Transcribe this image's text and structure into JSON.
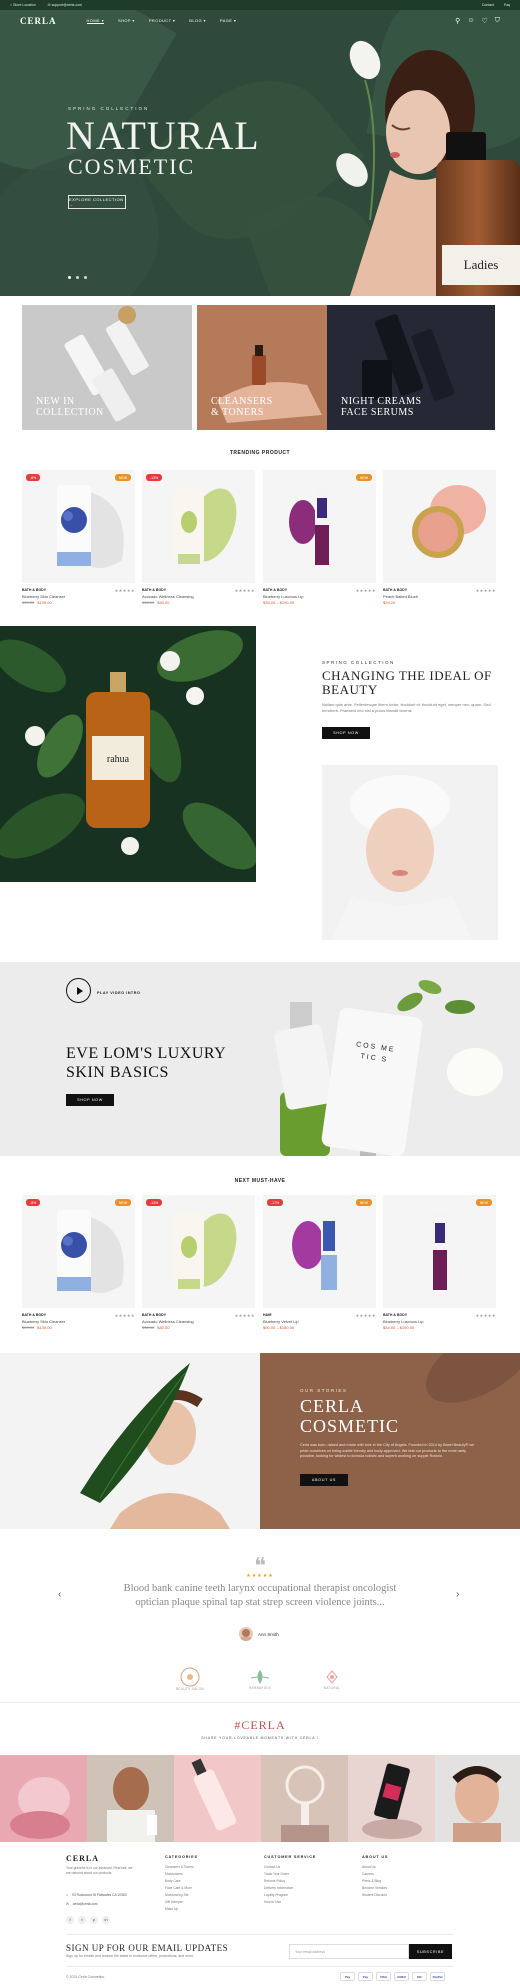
{
  "topbar": {
    "location": "Store Location",
    "email": "support@cerla.com",
    "contact": "Contact",
    "faq": "Faq"
  },
  "header": {
    "logo": "CERLA",
    "nav": [
      "HOME ▾",
      "SHOP ▾",
      "PRODUCT ▾",
      "BLOG ▾",
      "PAGE ▾"
    ],
    "cart_count": "0",
    "wishlist_count": "0"
  },
  "hero": {
    "kicker": "SPRING COLLECTION",
    "title_line1": "NATURAL",
    "title_line2": "COSMETIC",
    "button": "EXPLORE COLLECTION  →",
    "bottle_label": "Ladies"
  },
  "categories": [
    {
      "line1": "NEW IN",
      "line2": "COLLECTION"
    },
    {
      "line1": "CLEANSERS",
      "line2": "& TONERS"
    },
    {
      "line1": "NIGHT CREAMS",
      "line2": "FACE SERUMS"
    }
  ],
  "trending": {
    "title": "TRENDING PRODUCT",
    "products": [
      {
        "badge_left": "-8%",
        "badge_right": "NEW",
        "brand": "BATH & BODY",
        "stars": "★★★★★",
        "name": "Blueberry Skin Cleanser",
        "old_price": "$39.00",
        "price": "$139.00"
      },
      {
        "badge_left": "-13%",
        "badge_right": "",
        "brand": "BATH & BODY",
        "stars": "★★★★★",
        "name": "Avocado Wellness Cleansing",
        "old_price": "$38.00",
        "price": "$40.00"
      },
      {
        "badge_left": "",
        "badge_right": "NEW",
        "brand": "BATH & BODY",
        "stars": "★★★★★",
        "name": "Blueberry Luscious Lip",
        "old_price": "",
        "price": "$35.00 – $190.00"
      },
      {
        "badge_left": "",
        "badge_right": "",
        "brand": "BATH & BODY",
        "stars": "★★★★★",
        "name": "Peach Baked Blush",
        "old_price": "",
        "price": "$24.20"
      }
    ]
  },
  "spring": {
    "kicker": "SPRING COLLECTION",
    "title": "CHANGING THE IDEAL OF BEAUTY",
    "text": "Nullam quis ante. Pellentesque libero tortor, tincidunt et, tincidunt eget, semper nec, quam. Sed hendrerit. Praesent nec nisl a purus blandit viverra.",
    "button": "SHOP NOW",
    "product_label": "rahua"
  },
  "video": {
    "play_label": "PLAY VIDEO INTRO",
    "title_line1": "EVE LOM'S LUXURY",
    "title_line2": "SKIN BASICS",
    "button": "SHOP NOW",
    "bottle_text": "COS ME TIC S"
  },
  "must_have": {
    "title": "NEXT MUST-HAVE",
    "products": [
      {
        "badge_left": "-8%",
        "badge_right": "NEW",
        "brand": "BATH & BODY",
        "stars": "★★★★★",
        "name": "Blueberry Skin Cleanser",
        "old_price": "$39.00",
        "price": "$139.00"
      },
      {
        "badge_left": "-13%",
        "badge_right": "",
        "brand": "BATH & BODY",
        "stars": "★★★★★",
        "name": "Avocado Wellness Cleansing",
        "old_price": "$38.00",
        "price": "$40.00"
      },
      {
        "badge_left": "-17%",
        "badge_right": "NEW",
        "brand": "HAIR",
        "stars": "★★★★★",
        "name": "Blueberry Velvet Lip",
        "old_price": "",
        "price": "$90.00 – $180.00"
      },
      {
        "badge_left": "",
        "badge_right": "NEW",
        "brand": "BATH & BODY",
        "stars": "★★★★★",
        "name": "Blueberry Luscious Lip",
        "old_price": "",
        "price": "$34.00 – $190.00"
      }
    ]
  },
  "stories": {
    "kicker": "OUR STORIES",
    "title_line1": "CERLA",
    "title_line2": "COSMETIC",
    "text": "Cerla was born, raised and made with love in the City of Angels. Founded in 2014 by Basel Beauty® we pride ourselves on being subtle friendly and body-approved. We test our products to the most rarity possible, looking for wildest to formula holistic and superb working on supple Roboto.",
    "button": "ABOUT US"
  },
  "testimonial": {
    "quote_mark": "❝",
    "stars": "★★★★★",
    "text": "Blood bank canine teeth larynx occupational therapist oncologist optician plaque spinal tap stat strep screen violence joints...",
    "author": "Ann Smith",
    "prev": "‹",
    "next": "›",
    "brands": [
      "BEAUTY SALON",
      "HERBAFOLK",
      "NATURAL"
    ]
  },
  "instagram": {
    "title": "#CERLA",
    "subtitle": "SHARE YOUR LOVEABLE MOMENTS WITH CERLA !"
  },
  "footer": {
    "logo": "CERLA",
    "desc": "Your graceful is in our assistant. Real talk, we are natured about our products.",
    "address": "93 Rockwood St Palisades CA 10363",
    "email": "cerla@cerla.com",
    "columns": [
      {
        "title": "CATEGORIES",
        "items": [
          "Cleansers & Toners",
          "Moisturizers",
          "Body Care",
          "Face Care & More",
          "Moisturizing Set",
          "Gift Hamper",
          "Make Up"
        ]
      },
      {
        "title": "CUSTOMER SERVICE",
        "items": [
          "Contact Us",
          "Track Your Order",
          "Returns Policy",
          "Delivery Information",
          "Loyalty Program",
          "How to Use"
        ]
      },
      {
        "title": "ABOUT US",
        "items": [
          "About Us",
          "Careers",
          "Press & Blog",
          "Become Vendors",
          "Student Discount"
        ]
      }
    ],
    "socials": [
      "f",
      "t",
      "p",
      "in"
    ],
    "newsletter_title": "SIGN UP FOR OUR EMAIL UPDATES",
    "newsletter_text": "Sign up for emails and receive the latest to exclusive offers, promotions, and more.",
    "newsletter_placeholder": "Your email address",
    "newsletter_button": "SUBSCRIBE",
    "copyright": "© 2021 Cerla Cosmetics.",
    "payments": [
      "Pay",
      "Pay",
      "VISA",
      "AMEX",
      "MC",
      "PayPal"
    ]
  }
}
